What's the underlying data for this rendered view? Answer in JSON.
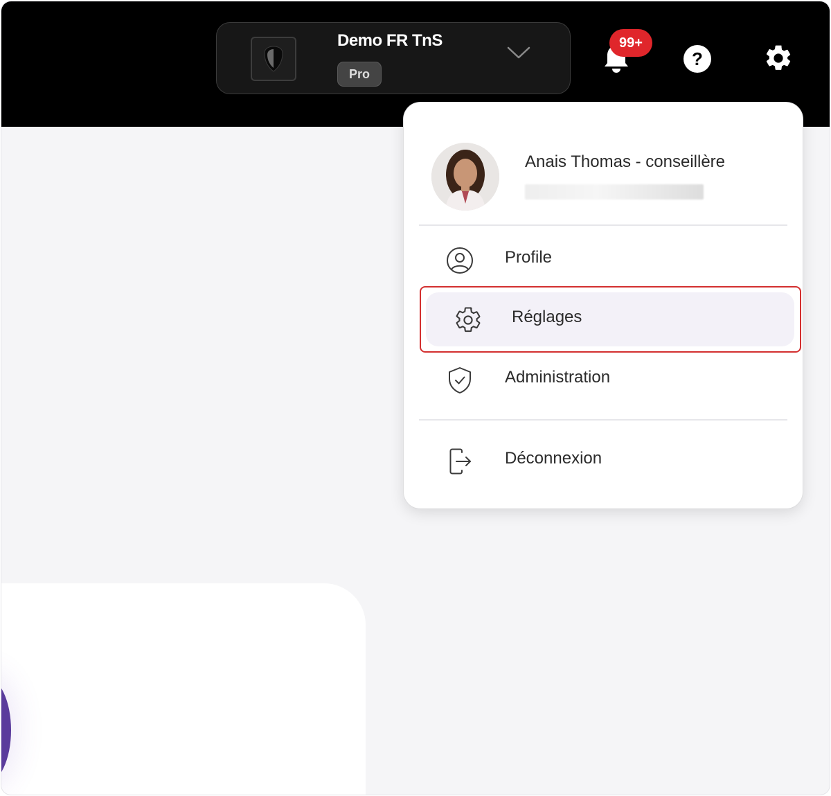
{
  "header": {
    "org_name": "Demo FR TnS",
    "org_plan": "Pro",
    "notifications_count": "99+"
  },
  "user_menu": {
    "user_name": "Anais Thomas - conseillère",
    "items": [
      {
        "label": "Profile",
        "icon": "user-circle-icon"
      },
      {
        "label": "Réglages",
        "icon": "settings-gear-icon",
        "selected": true
      },
      {
        "label": "Administration",
        "icon": "shield-check-icon"
      },
      {
        "label": "Déconnexion",
        "icon": "logout-icon"
      }
    ]
  },
  "colors": {
    "topbar": "#000000",
    "badge": "#e0262b",
    "highlight": "#d32f2f",
    "accent": "#5a3b9c"
  }
}
